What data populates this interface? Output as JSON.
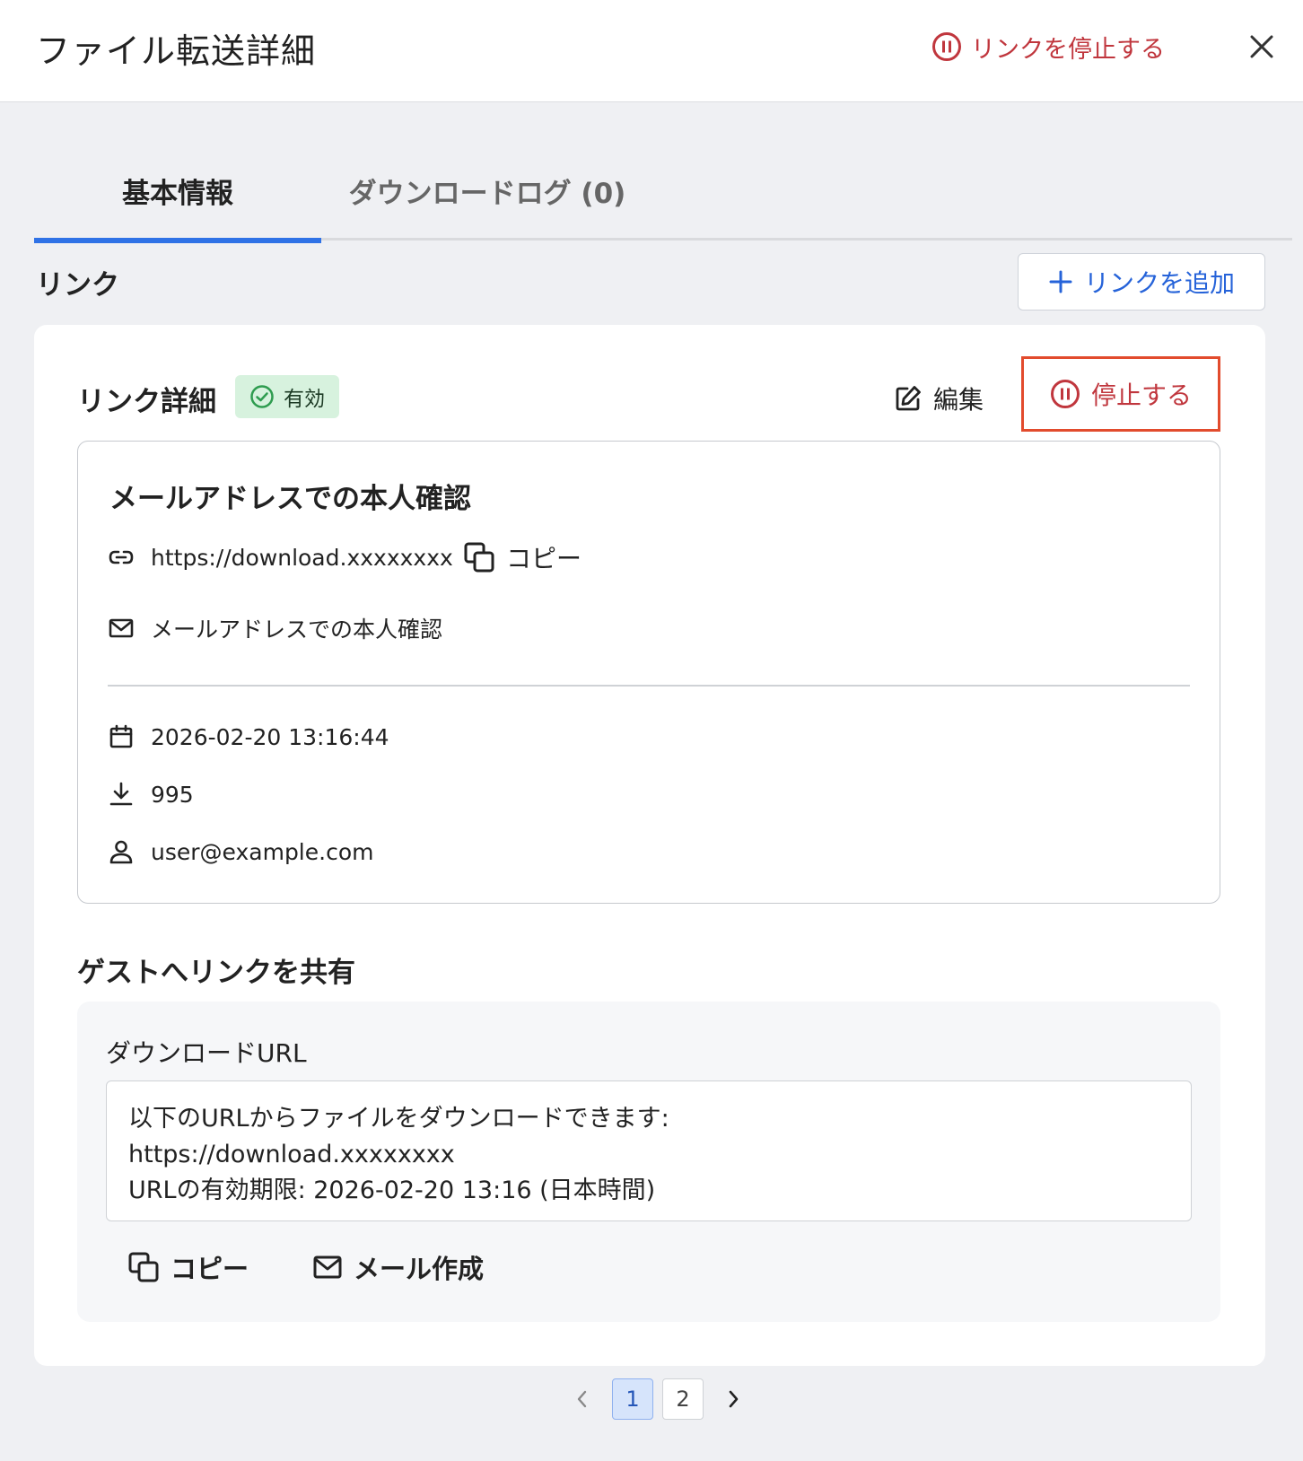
{
  "header": {
    "title": "ファイル転送詳細",
    "stop_link_label": "リンクを停止する"
  },
  "tabs": [
    {
      "label": "基本情報",
      "active": true
    },
    {
      "label": "ダウンロードログ (0)",
      "active": false
    }
  ],
  "links_section": {
    "title": "リンク",
    "add_link_label": "リンクを追加"
  },
  "link_detail": {
    "title": "リンク詳細",
    "status_badge": "有効",
    "edit_label": "編集",
    "stop_label": "停止する",
    "auth_method_heading": "メールアドレスでの本人確認",
    "url": "https://download.xxxxxxxx",
    "copy_label": "コピー",
    "auth_method": "メールアドレスでの本人確認",
    "expiry": "2026-02-20 13:16:44",
    "download_count": "995",
    "user": "user@example.com"
  },
  "share": {
    "title": "ゲストへリンクを共有",
    "download_url_label": "ダウンロードURL",
    "message": "以下のURLからファイルをダウンロードできます:\nhttps://download.xxxxxxxx\nURLの有効期限: 2026-02-20 13:16 (日本時間)",
    "copy_label": "コピー",
    "compose_mail_label": "メール作成"
  },
  "pagination": {
    "current": "1",
    "pages": [
      "1",
      "2"
    ]
  },
  "colors": {
    "accent_blue": "#2f72e6",
    "danger_red": "#c0363d",
    "highlight_border": "#e24b2d",
    "badge_green": "#d7f2de"
  }
}
